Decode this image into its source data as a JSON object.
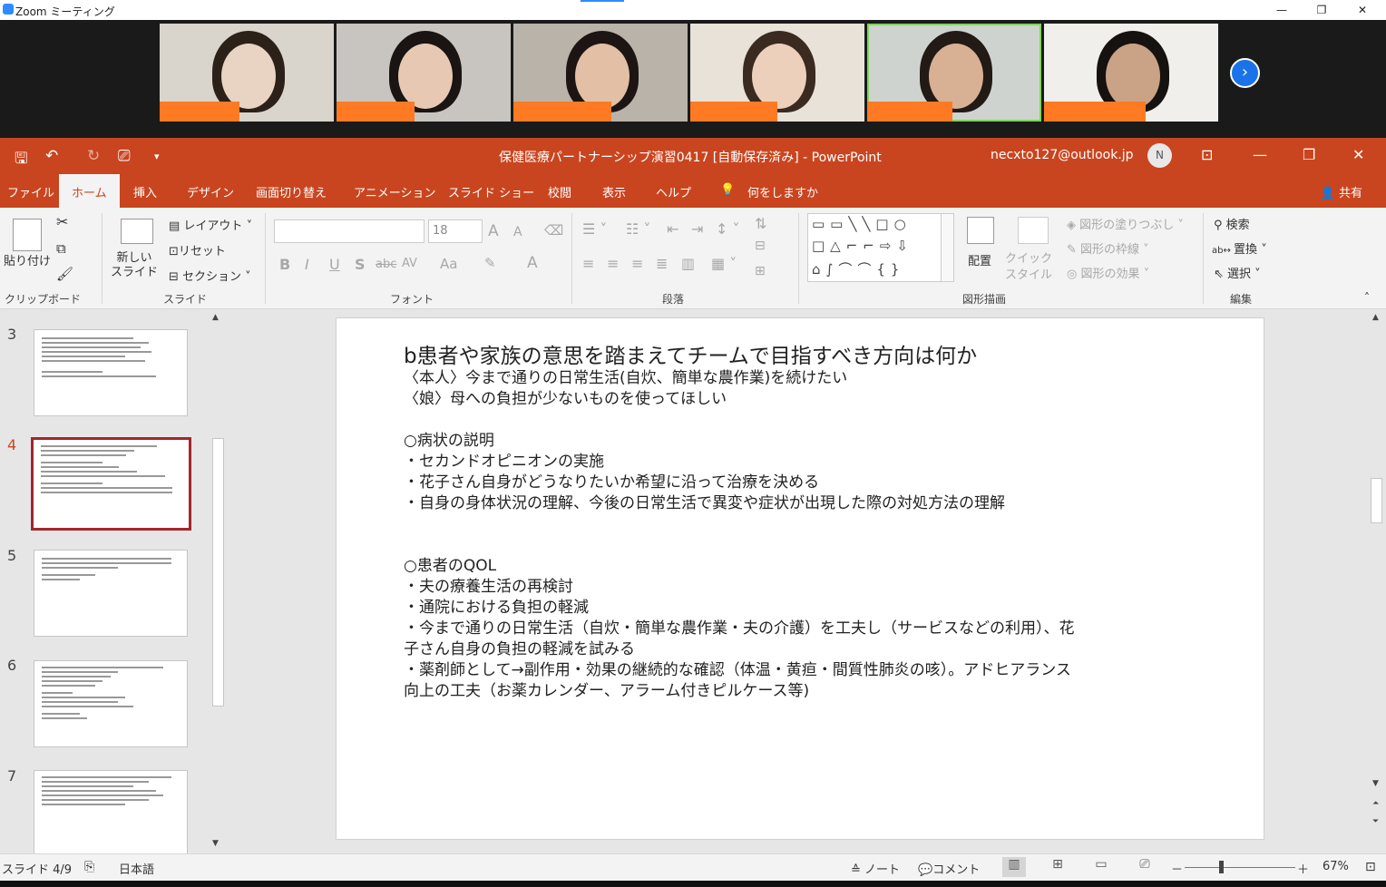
{
  "zoom": {
    "window_title": "Zoom ミーティング",
    "minimize": "—",
    "maximize": "❐",
    "close": "✕",
    "next_arrow": "›"
  },
  "participants": [
    {
      "skin": "#e9d3c2",
      "hair": "#2b2119",
      "bg": "#d9d4cc"
    },
    {
      "skin": "#e7c9b3",
      "hair": "#1a1412",
      "bg": "#c8c5c0"
    },
    {
      "skin": "#e2bfa5",
      "hair": "#1c1513",
      "bg": "#b9b3aa"
    },
    {
      "skin": "#ecd0bb",
      "hair": "#3a2a20",
      "bg": "#e8e2d8"
    },
    {
      "skin": "#d8b094",
      "hair": "#221a15",
      "bg": "#cfd3cf"
    },
    {
      "skin": "#caa285",
      "hair": "#161210",
      "bg": "#f0efec"
    }
  ],
  "ppt": {
    "title": "保健医療パートナーシップ演習0417 [自動保存済み]  -  PowerPoint",
    "account": "necxto127@outlook.jp",
    "avatar_initial": "N",
    "qat": {
      "save": "🖫",
      "undo": "↶",
      "redo": "↻",
      "present": "⎚",
      "more": "▾"
    },
    "window": {
      "ribbon_opts": "⊡",
      "minimize": "—",
      "restore": "❐",
      "close": "✕"
    }
  },
  "tabs": [
    "ファイル",
    "ホーム",
    "挿入",
    "デザイン",
    "画面切り替え",
    "アニメーション",
    "スライド ショー",
    "校閲",
    "表示",
    "ヘルプ",
    "何をしますか"
  ],
  "share": "共有",
  "ribbon": {
    "clipboard": {
      "paste": "貼り付け",
      "label": "クリップボード"
    },
    "slides": {
      "new_slide": "新しい\nスライド",
      "layout": "レイアウト",
      "reset": "リセット",
      "section": "セクション",
      "label": "スライド"
    },
    "font": {
      "size": "18",
      "label": "フォント",
      "bold": "B",
      "italic": "I",
      "underline": "U",
      "shadow": "S",
      "strike": "abc",
      "spacing": "AV",
      "case": "Aa",
      "grow": "A",
      "shrink": "A",
      "color": "A"
    },
    "paragraph": {
      "label": "段落"
    },
    "drawing": {
      "arrange": "配置",
      "quick_styles": "クイック\nスタイル",
      "fill": "図形の塗りつぶし",
      "outline": "図形の枠線",
      "effects": "図形の効果",
      "label": "図形描画"
    },
    "editing": {
      "find": "検索",
      "replace": "置換",
      "select": "選択",
      "label": "編集"
    }
  },
  "thumbnails": [
    {
      "num": "3"
    },
    {
      "num": "4"
    },
    {
      "num": "5"
    },
    {
      "num": "6"
    },
    {
      "num": "7"
    }
  ],
  "slide": {
    "title": "b患者や家族の意思を踏まえてチームで目指すべき方向は何か",
    "lines": [
      "〈本人〉今まで通りの日常生活(自炊、簡単な農作業)を続けたい",
      "〈娘〉母への負担が少ないものを使ってほしい",
      "",
      "○病状の説明",
      "・セカンドオピニオンの実施",
      "・花子さん自身がどうなりたいか希望に沿って治療を決める",
      "・自身の身体状況の理解、今後の日常生活で異変や症状が出現した際の対処方法の理解",
      "",
      "",
      "○患者のQOL",
      "・夫の療養生活の再検討",
      "・通院における負担の軽減",
      "・今まで通りの日常生活（自炊・簡単な農作業・夫の介護）を工夫し（サービスなどの利用）、花",
      "子さん自身の負担の軽減を試みる",
      "・薬剤師として→副作用・効果の継続的な確認（体温・黄疸・間質性肺炎の咳）。アドヒアランス",
      "向上の工夫（お薬カレンダー、アラーム付きピルケース等)"
    ]
  },
  "status": {
    "slide_count": "スライド 4/9",
    "language": "日本語",
    "notes": "ノート",
    "comments": "コメント",
    "zoom_minus": "－",
    "zoom_plus": "＋",
    "zoom": "67%",
    "zoom_fraction": 0.33
  }
}
